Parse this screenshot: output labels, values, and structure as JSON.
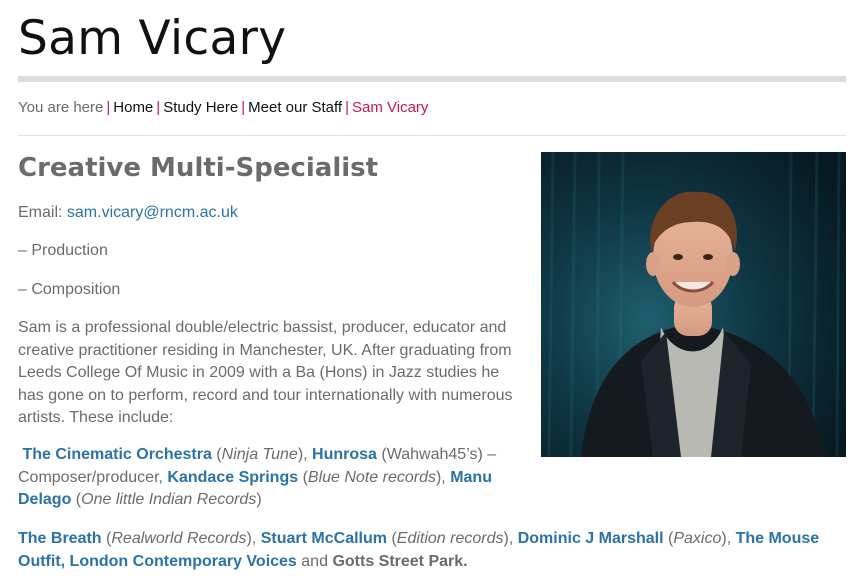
{
  "page": {
    "title": "Sam Vicary",
    "subtitle": "Creative Multi-Specialist"
  },
  "breadcrumb": {
    "prefix": "You are here",
    "separator": "|",
    "items": [
      "Home",
      "Study Here",
      "Meet our Staff"
    ],
    "current": "Sam Vicary"
  },
  "contact": {
    "email_label": "Email:",
    "email": "sam.vicary@rncm.ac.uk"
  },
  "specialisms": [
    "– Production",
    "– Composition"
  ],
  "bio": "Sam is a professional double/electric bassist, producer, educator and creative practitioner residing in Manchester, UK. After graduating from Leeds College Of Music in 2009 with a Ba (Hons) in Jazz studies he has gone on to perform, record and tour internationally with numerous artists. These include:",
  "artists": {
    "a1_name": "The Cinematic Orchestra",
    "a1_label": "Ninja Tune",
    "a2_name": "Hunrosa",
    "a2_label": "Wahwah45’s",
    "a2_role": "Composer/producer,",
    "a3_name": "Kandace Springs",
    "a3_label": "Blue Note records",
    "a4_name": "Manu Delago",
    "a4_label": "One little Indian Records",
    "a5_name": "The Breath",
    "a5_label": "Realworld Records",
    "a6_name": "Stuart McCallum",
    "a6_label": "Edition records",
    "a7_name": "Dominic J Marshall",
    "a7_label": "Paxico",
    "a8_name": "The Mouse Outfit,",
    "a9_name": "London Contemporary Voices",
    "and": "and",
    "a10_name": "Gotts Street Park."
  },
  "colors": {
    "accent": "#c6185a",
    "link": "#2a72a8",
    "text": "#6b6b6b",
    "heading": "#111111"
  },
  "icons": [
    "portrait-photo"
  ]
}
